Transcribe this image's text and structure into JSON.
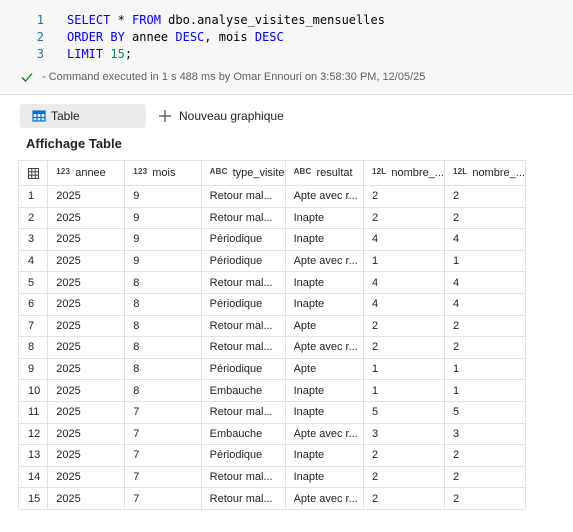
{
  "code": {
    "lines": [
      {
        "no": "1",
        "parts": [
          [
            "kw",
            "SELECT"
          ],
          [
            "id",
            " * "
          ],
          [
            "kw",
            "FROM"
          ],
          [
            "id",
            " dbo.analyse_visites_mensuelles"
          ]
        ]
      },
      {
        "no": "2",
        "parts": [
          [
            "kw",
            "ORDER BY"
          ],
          [
            "id",
            " annee "
          ],
          [
            "kw",
            "DESC"
          ],
          [
            "id",
            ", mois "
          ],
          [
            "kw",
            "DESC"
          ]
        ]
      },
      {
        "no": "3",
        "parts": [
          [
            "kw",
            "LIMIT"
          ],
          [
            "id",
            " "
          ],
          [
            "num",
            "15"
          ],
          [
            "id",
            ";"
          ]
        ]
      }
    ],
    "status": "- Command executed in 1 s 488 ms by Omar Ennouri on 3:58:30 PM, 12/05/25"
  },
  "toolbar": {
    "table_label": "Table",
    "new_chart_label": "Nouveau graphique"
  },
  "view_title": "Affichage Table",
  "colors": {
    "keyword": "#0000ff",
    "line_number": "#237893",
    "number": "#098658",
    "check": "#107c10"
  },
  "table": {
    "columns": [
      {
        "type": "123",
        "name": "annee"
      },
      {
        "type": "123",
        "name": "mois"
      },
      {
        "type": "ABC",
        "name": "type_visite"
      },
      {
        "type": "ABC",
        "name": "resultat"
      },
      {
        "type": "12L",
        "name": "nombre_..."
      },
      {
        "type": "12L",
        "name": "nombre_..."
      }
    ],
    "rows": [
      [
        "1",
        "2025",
        "9",
        "Retour mal...",
        "Apte avec r...",
        "2",
        "2"
      ],
      [
        "2",
        "2025",
        "9",
        "Retour mal...",
        "Inapte",
        "2",
        "2"
      ],
      [
        "3",
        "2025",
        "9",
        "Périodique",
        "Inapte",
        "4",
        "4"
      ],
      [
        "4",
        "2025",
        "9",
        "Périodique",
        "Apte avec r...",
        "1",
        "1"
      ],
      [
        "5",
        "2025",
        "8",
        "Retour mal...",
        "Inapte",
        "4",
        "4"
      ],
      [
        "6",
        "2025",
        "8",
        "Périodique",
        "Inapte",
        "4",
        "4"
      ],
      [
        "7",
        "2025",
        "8",
        "Retour mal...",
        "Apte",
        "2",
        "2"
      ],
      [
        "8",
        "2025",
        "8",
        "Retour mal...",
        "Apte avec r...",
        "2",
        "2"
      ],
      [
        "9",
        "2025",
        "8",
        "Périodique",
        "Apte",
        "1",
        "1"
      ],
      [
        "10",
        "2025",
        "8",
        "Embauche",
        "Inapte",
        "1",
        "1"
      ],
      [
        "11",
        "2025",
        "7",
        "Retour mal...",
        "Inapte",
        "5",
        "5"
      ],
      [
        "12",
        "2025",
        "7",
        "Embauche",
        "Apte avec r...",
        "3",
        "3"
      ],
      [
        "13",
        "2025",
        "7",
        "Périodique",
        "Inapte",
        "2",
        "2"
      ],
      [
        "14",
        "2025",
        "7",
        "Retour mal...",
        "Inapte",
        "2",
        "2"
      ],
      [
        "15",
        "2025",
        "7",
        "Retour mal...",
        "Apte avec r...",
        "2",
        "2"
      ]
    ]
  }
}
